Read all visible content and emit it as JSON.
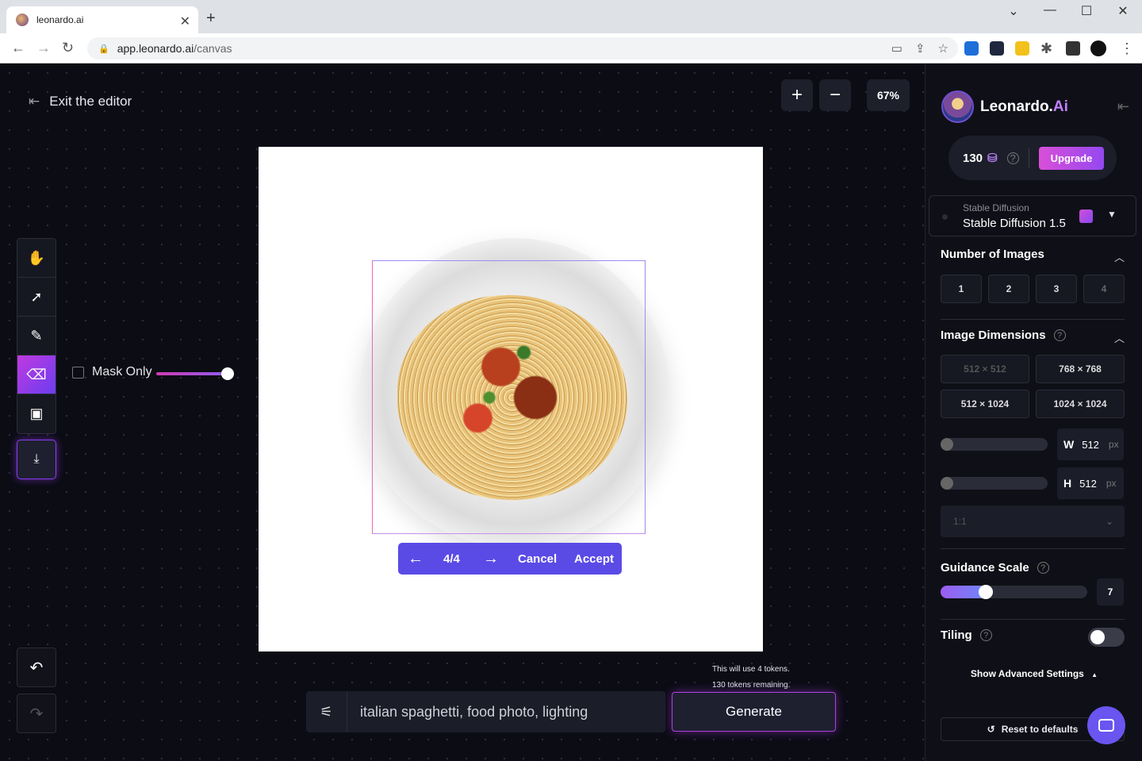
{
  "browser": {
    "tab_title": "leonardo.ai",
    "url_host": "app.leonardo.ai",
    "url_path": "/canvas"
  },
  "editor": {
    "exit_label": "Exit the editor",
    "zoom": "67%",
    "mask_only_label": "Mask Only",
    "mask_brush_level": 1.0,
    "variant_counter": "4/4",
    "cancel_label": "Cancel",
    "accept_label": "Accept",
    "prompt_text": "italian spaghetti, food photo, lighting",
    "token_use": "This will use 4 tokens.",
    "token_remaining": "130 tokens remaining.",
    "generate_label": "Generate"
  },
  "sidebar": {
    "brand": "Leonardo.",
    "brand_suffix": "Ai",
    "credits": "130",
    "upgrade_label": "Upgrade",
    "model_family": "Stable Diffusion",
    "model_name": "Stable Diffusion 1.5",
    "num_images_title": "Number of Images",
    "num_images_options": [
      "1",
      "2",
      "3",
      "4"
    ],
    "dimensions_title": "Image Dimensions",
    "dimension_options": [
      "512 × 512",
      "768 × 768",
      "512 × 1024",
      "1024 × 1024"
    ],
    "width_label": "W",
    "width_value": "512",
    "height_label": "H",
    "height_value": "512",
    "unit": "px",
    "aspect_ratio": "1:1",
    "guidance_title": "Guidance Scale",
    "guidance_value": "7",
    "tiling_title": "Tiling",
    "tiling_on": false,
    "advanced_label": "Show Advanced Settings",
    "reset_label": "Reset to defaults"
  },
  "colors": {
    "accent_purple": "#5b4be6",
    "gradient_pink": "#d94fd8",
    "gradient_violet": "#9448f0",
    "background": "#0b0c14"
  }
}
